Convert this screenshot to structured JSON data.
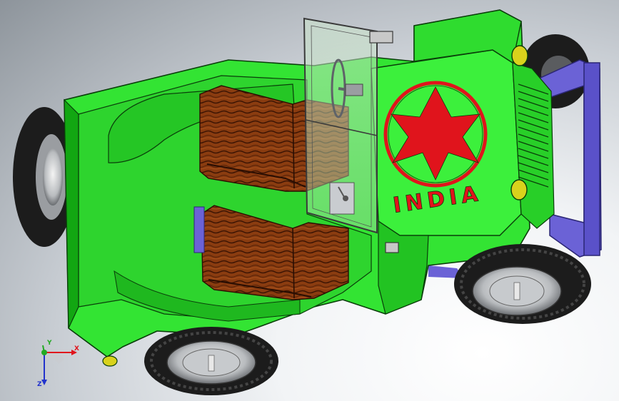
{
  "model": {
    "decal_text": "INDIA"
  },
  "triad": {
    "x_label": "X",
    "y_label": "Y",
    "z_label": "Z"
  },
  "colors": {
    "body": "#33e433",
    "body_dark": "#12a612",
    "outline": "#0a3d0a",
    "bumper": "#6b62d6",
    "decal": "#e0141c",
    "tire": "#1c1c1c",
    "seat": "#8a3c10"
  }
}
